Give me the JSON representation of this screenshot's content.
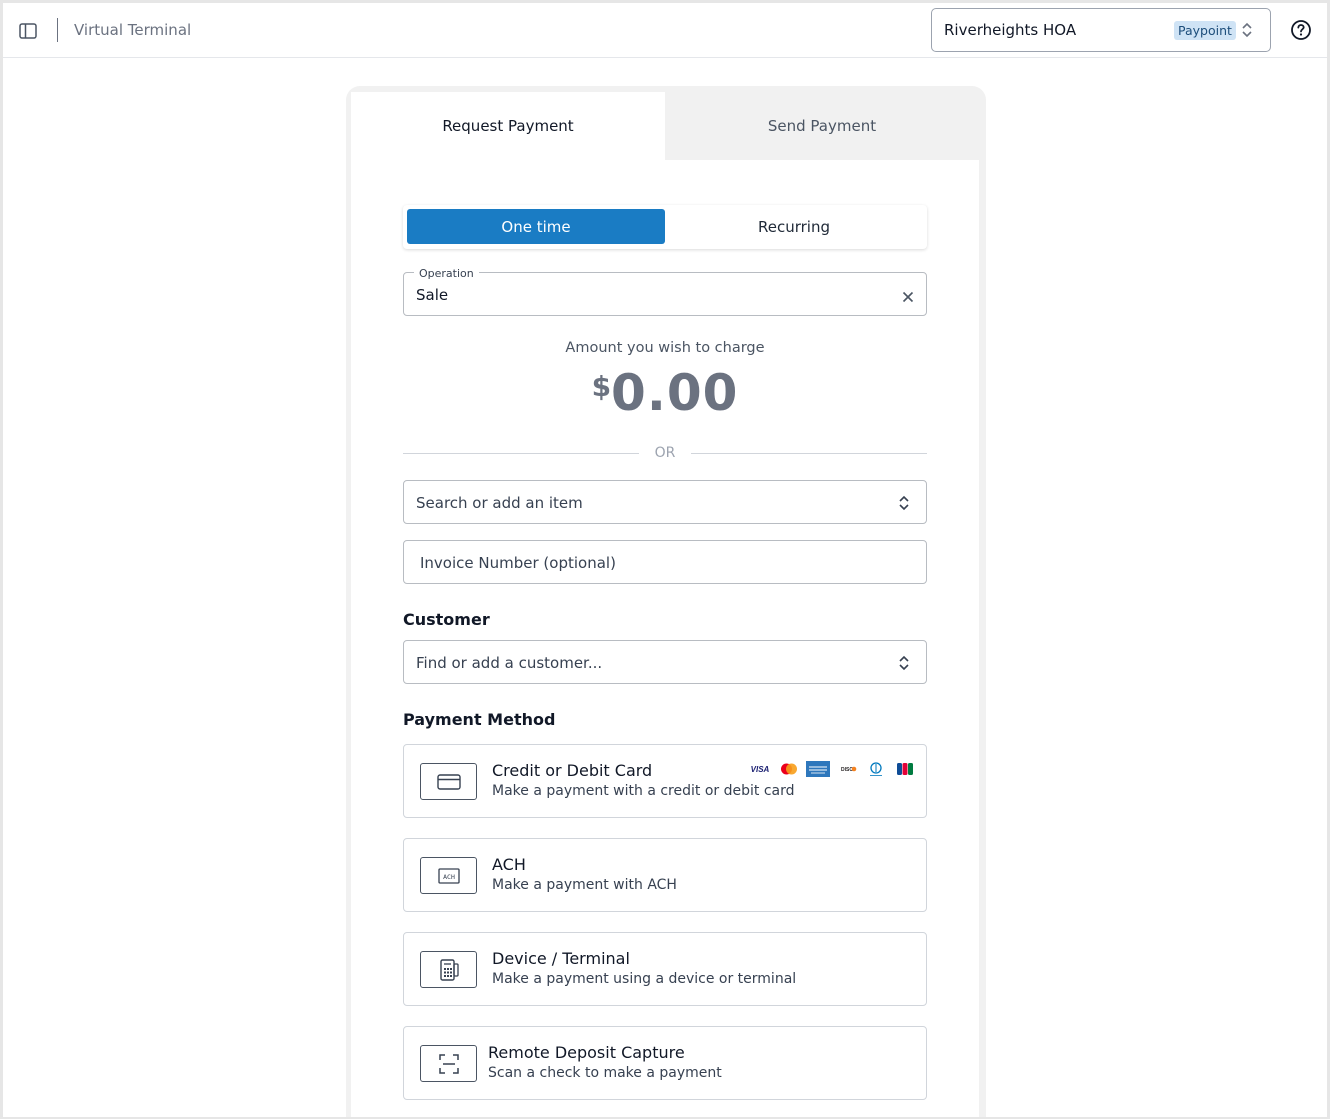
{
  "header": {
    "title": "Virtual Terminal",
    "account_name": "Riverheights HOA",
    "account_badge": "Paypoint"
  },
  "tabs": {
    "request": "Request Payment",
    "send": "Send Payment"
  },
  "frequency": {
    "one_time": "One time",
    "recurring": "Recurring",
    "selected": "One time"
  },
  "operation": {
    "label": "Operation",
    "value": "Sale"
  },
  "amount": {
    "label": "Amount you wish to charge",
    "currency": "$",
    "value": "0.00"
  },
  "divider_text": "OR",
  "item_search": {
    "placeholder": "Search or add an item"
  },
  "invoice": {
    "placeholder": "Invoice Number (optional)"
  },
  "customer": {
    "title": "Customer",
    "placeholder": "Find or add a customer..."
  },
  "payment_method": {
    "title": "Payment Method",
    "options": [
      {
        "title": "Credit or Debit Card",
        "description": "Make a payment with a credit or debit card",
        "icon": "credit-card-icon"
      },
      {
        "title": "ACH",
        "description": "Make a payment with ACH",
        "icon": "ach-icon",
        "icon_text": "ACH"
      },
      {
        "title": "Device / Terminal",
        "description": "Make a payment using a device or terminal",
        "icon": "terminal-icon"
      },
      {
        "title": "Remote Deposit Capture",
        "description": "Scan a check to make a payment",
        "icon": "scan-icon"
      }
    ],
    "card_brands": [
      "VISA",
      "mastercard",
      "AMERICAN EXPRESS",
      "DISCOVER",
      "Diners Club",
      "JCB"
    ]
  },
  "colors": {
    "primary": "#1a7cc4",
    "badge_bg": "#cfe3f5",
    "tab_inactive_bg": "#f1f1f1"
  }
}
